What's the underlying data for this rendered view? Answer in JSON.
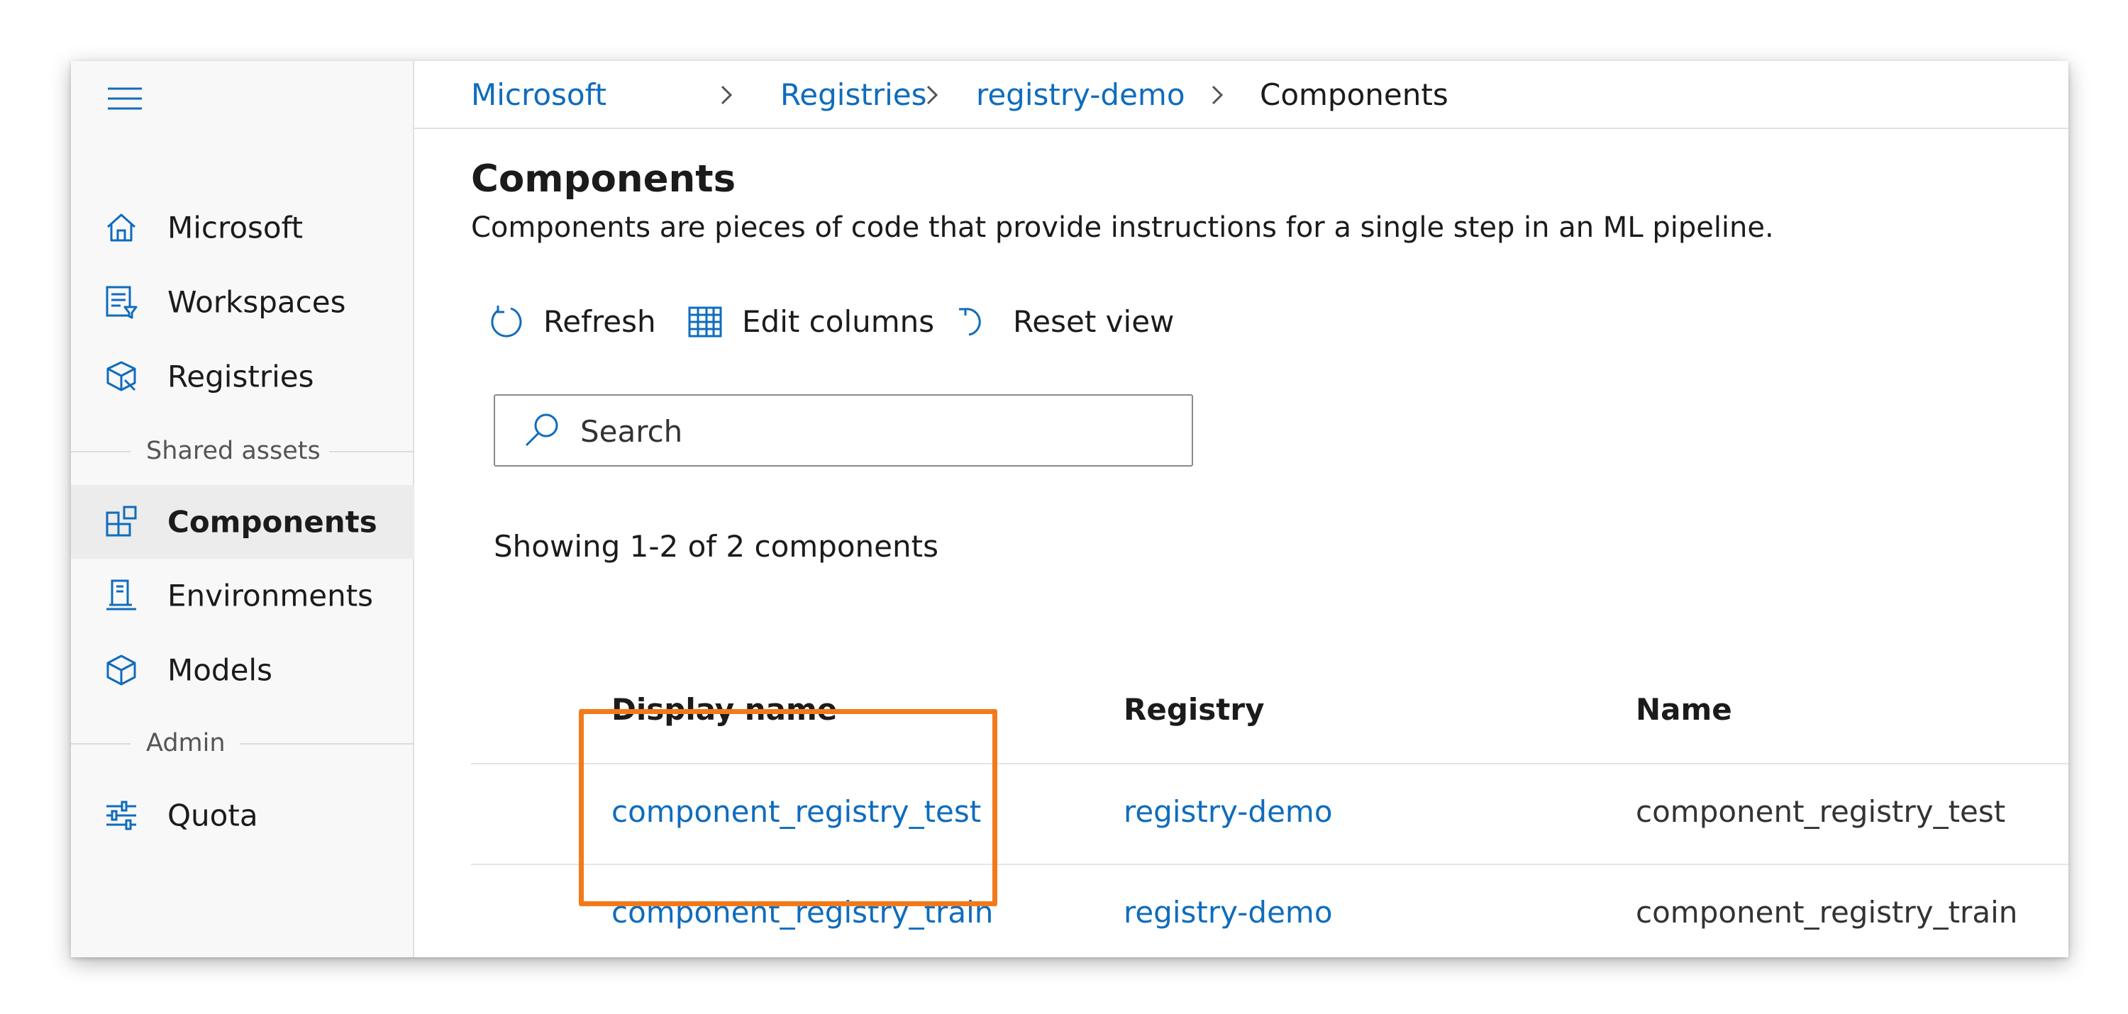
{
  "sidebar": {
    "nav_top": [
      {
        "label": "Microsoft",
        "icon": "home-icon"
      },
      {
        "label": "Workspaces",
        "icon": "workspaces-icon"
      },
      {
        "label": "Registries",
        "icon": "registries-icon"
      }
    ],
    "section_shared": "Shared assets",
    "nav_shared": [
      {
        "label": "Components",
        "icon": "components-icon",
        "selected": true
      },
      {
        "label": "Environments",
        "icon": "environments-icon"
      },
      {
        "label": "Models",
        "icon": "models-icon"
      }
    ],
    "section_admin": "Admin",
    "nav_admin": [
      {
        "label": "Quota",
        "icon": "quota-icon"
      }
    ]
  },
  "breadcrumb": [
    "Microsoft",
    "Registries",
    "registry-demo",
    "Components"
  ],
  "page": {
    "title": "Components",
    "description": "Components are pieces of code that provide instructions for a single step in an ML pipeline."
  },
  "toolbar": {
    "refresh": "Refresh",
    "edit_columns": "Edit columns",
    "reset_view": "Reset view"
  },
  "search": {
    "placeholder": "Search",
    "value": ""
  },
  "count_text": "Showing 1-2 of 2 components",
  "table": {
    "columns": [
      "Display name",
      "Registry",
      "Name"
    ],
    "rows": [
      {
        "display_name": "component_registry_test",
        "registry": "registry-demo",
        "name": "component_registry_test"
      },
      {
        "display_name": "component_registry_train",
        "registry": "registry-demo",
        "name": "component_registry_train"
      }
    ]
  },
  "colors": {
    "link": "#0f6cbd",
    "highlight": "#f27a1a",
    "sidebar_bg": "#f8f8f8",
    "selected_bg": "#ececec"
  }
}
